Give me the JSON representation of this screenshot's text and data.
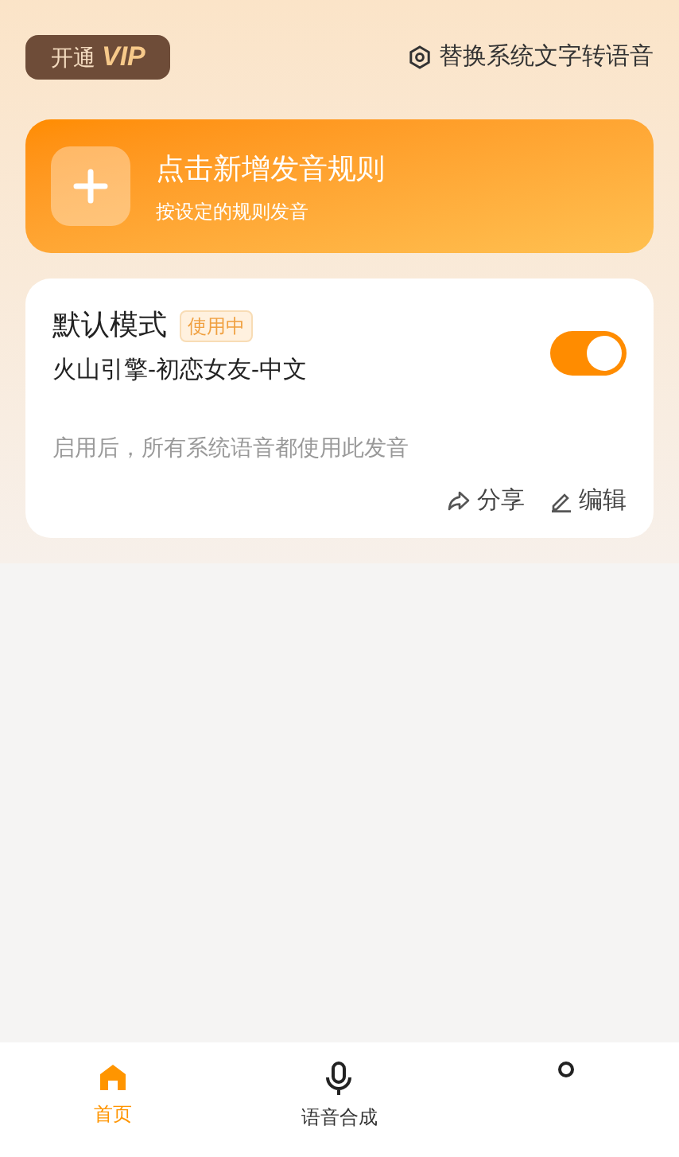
{
  "header": {
    "vip_button": {
      "prefix": "开通",
      "label": "VIP"
    },
    "replace_link": "替换系统文字转语音"
  },
  "add_rule": {
    "title": "点击新增发音规则",
    "subtitle": "按设定的规则发音"
  },
  "rules": [
    {
      "name": "默认模式",
      "badge": "使用中",
      "voice": "火山引擎-初恋女友-中文",
      "on": true,
      "description": "启用后，所有系统语音都使用此发音",
      "actions": [
        {
          "kind": "share",
          "label": "分享"
        },
        {
          "kind": "edit",
          "label": "编辑"
        }
      ]
    }
  ],
  "tab_bar": [
    {
      "kind": "home",
      "label": "首页",
      "selected": true
    },
    {
      "kind": "mic",
      "label": "语音合成",
      "selected": false
    },
    {
      "kind": "user",
      "selected": false
    }
  ]
}
